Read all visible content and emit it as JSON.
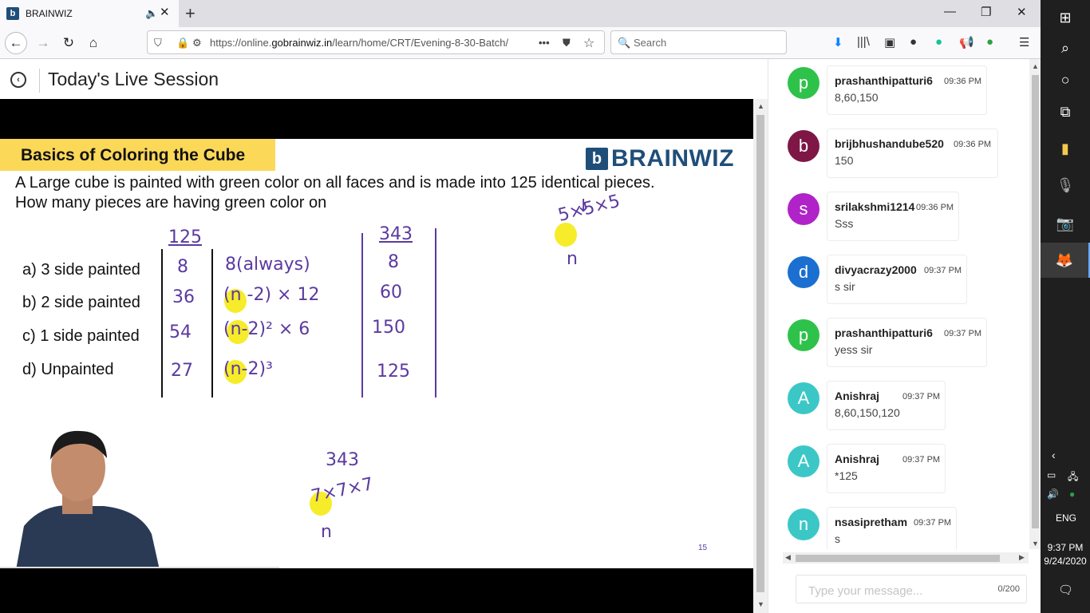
{
  "browser": {
    "tab_title": "BRAINWIZ",
    "favicon": "b",
    "url_prefix": "https://online.",
    "url_domain": "gobrainwiz.in",
    "url_path": "/learn/home/CRT/Evening-8-30-Batch/",
    "search_placeholder": "Search"
  },
  "page": {
    "title": "Today's Live Session"
  },
  "slide": {
    "banner": "Basics of Coloring the Cube",
    "brand": "BRAINWIZ",
    "brand_logo": "b",
    "question_line1": "A Large cube is painted with green color on all faces and is made into 125 identical pieces.",
    "question_line2": "How many pieces are having green color on",
    "options": [
      "a) 3 side painted",
      "b) 2 side painted",
      "c) 1 side painted",
      "d) Unpainted"
    ],
    "handwriting": {
      "col1_header": "125",
      "col1": [
        "8",
        "36",
        "54",
        "27"
      ],
      "col2": [
        "8(always)",
        "(n -2) × 12",
        "(n-2)² × 6",
        "(n-2)³"
      ],
      "col3_header": "343",
      "col3": [
        "8",
        "60",
        "150",
        "125"
      ],
      "top_right_expr": "5×5×5",
      "top_right_n": "n",
      "arrow": "↓",
      "bottom_number": "343",
      "bottom_expr": "7×7×7",
      "bottom_n": "n"
    },
    "slide_number": "15"
  },
  "chat": {
    "messages": [
      {
        "initial": "p",
        "name": "prashanthipatturi6",
        "time": "09:36 PM",
        "text": "8,60,150",
        "color": "#2ec24a"
      },
      {
        "initial": "b",
        "name": "brijbhushandube520",
        "time": "09:36 PM",
        "text": "150",
        "color": "#7e1746"
      },
      {
        "initial": "s",
        "name": "srilakshmi1214",
        "time": "09:36 PM",
        "text": "Sss",
        "color": "#b023c9"
      },
      {
        "initial": "d",
        "name": "divyacrazy2000",
        "time": "09:37 PM",
        "text": "s sir",
        "color": "#1a6fd1"
      },
      {
        "initial": "p",
        "name": "prashanthipatturi6",
        "time": "09:37 PM",
        "text": "yess sir",
        "color": "#2ec24a"
      },
      {
        "initial": "A",
        "name": "Anishraj",
        "time": "09:37 PM",
        "text": "8,60,150,120",
        "color": "#3cc7c7"
      },
      {
        "initial": "A",
        "name": "Anishraj",
        "time": "09:37 PM",
        "text": "*125",
        "color": "#3cc7c7"
      },
      {
        "initial": "n",
        "name": "nsasipretham",
        "time": "09:37 PM",
        "text": "s",
        "color": "#3cc7c7"
      }
    ],
    "input_placeholder": "Type your message...",
    "char_count": "0/200"
  },
  "taskbar": {
    "language": "ENG",
    "time": "9:37 PM",
    "date": "9/24/2020"
  },
  "colors": {
    "banner": "#fcd859",
    "brand": "#1f4e79",
    "handwriting": "#5b3aa0",
    "highlight": "#f6ec2a"
  }
}
